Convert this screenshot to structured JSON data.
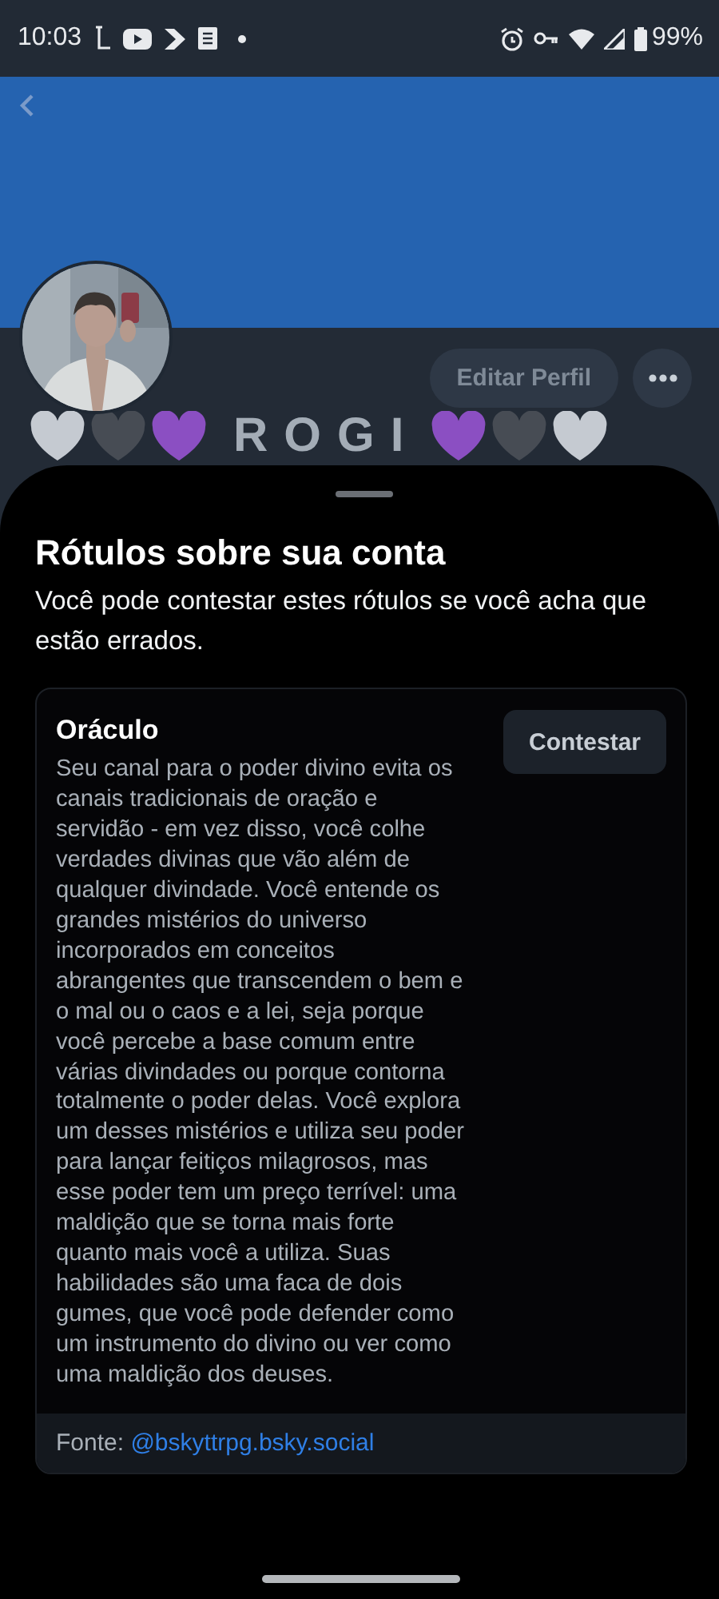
{
  "status_bar": {
    "time": "10:03",
    "battery": "99%"
  },
  "profile": {
    "edit_button": "Editar Perfil",
    "display_name": "ROGI",
    "hearts_before": [
      {
        "color": "#c5cad1"
      },
      {
        "color": "#474c54"
      },
      {
        "color": "#8b4fc2"
      }
    ],
    "hearts_after": [
      {
        "color": "#8b4fc2"
      },
      {
        "color": "#474c54"
      },
      {
        "color": "#c5cad1"
      }
    ]
  },
  "sheet": {
    "title": "Rótulos sobre sua conta",
    "subtitle": "Você pode contestar estes rótulos se você acha que estão errados.",
    "labels": [
      {
        "name": "Oráculo",
        "action": "Contestar",
        "description": "Seu canal para o poder divino evita os canais tradicionais de oração e servidão - em vez disso, você colhe verdades divinas que vão além de qualquer divindade. Você entende os grandes mistérios do universo incorporados em conceitos abrangentes que transcendem o bem e o mal ou o caos e a lei, seja porque você percebe a base comum entre várias divindades ou porque contorna totalmente o poder delas. Você explora um desses mistérios e utiliza seu poder para lançar feitiços milagrosos, mas esse poder tem um preço terrível: uma maldição que se torna mais forte quanto mais você a utiliza. Suas habilidades são uma faca de dois gumes, que você pode defender como um instrumento do divino ou ver como uma maldição dos deuses.",
        "source_label": "Fonte:",
        "source_handle": "@bskyttrpg.bsky.social"
      }
    ]
  }
}
